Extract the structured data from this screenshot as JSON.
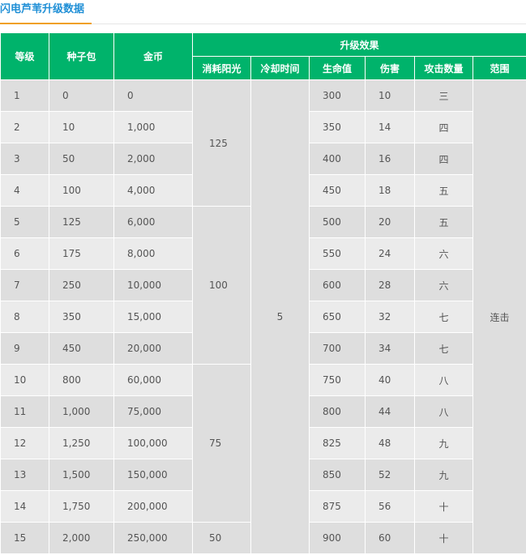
{
  "page_title": "闪电芦苇升级数据",
  "headers": {
    "level": "等级",
    "seeds": "种子包",
    "coins": "金币",
    "effect_group": "升级效果",
    "sun_cost": "消耗阳光",
    "cooldown": "冷却时间",
    "hp": "生命值",
    "damage": "伤害",
    "attack_count": "攻击数量",
    "range": "范围"
  },
  "rows": [
    {
      "level": "1",
      "seeds": "0",
      "coins": "0",
      "hp": "300",
      "damage": "10",
      "count": "三"
    },
    {
      "level": "2",
      "seeds": "10",
      "coins": "1,000",
      "hp": "350",
      "damage": "14",
      "count": "四"
    },
    {
      "level": "3",
      "seeds": "50",
      "coins": "2,000",
      "hp": "400",
      "damage": "16",
      "count": "四"
    },
    {
      "level": "4",
      "seeds": "100",
      "coins": "4,000",
      "hp": "450",
      "damage": "18",
      "count": "五"
    },
    {
      "level": "5",
      "seeds": "125",
      "coins": "6,000",
      "hp": "500",
      "damage": "20",
      "count": "五"
    },
    {
      "level": "6",
      "seeds": "175",
      "coins": "8,000",
      "hp": "550",
      "damage": "24",
      "count": "六"
    },
    {
      "level": "7",
      "seeds": "250",
      "coins": "10,000",
      "hp": "600",
      "damage": "28",
      "count": "六"
    },
    {
      "level": "8",
      "seeds": "350",
      "coins": "15,000",
      "hp": "650",
      "damage": "32",
      "count": "七"
    },
    {
      "level": "9",
      "seeds": "450",
      "coins": "20,000",
      "hp": "700",
      "damage": "34",
      "count": "七"
    },
    {
      "level": "10",
      "seeds": "800",
      "coins": "60,000",
      "hp": "750",
      "damage": "40",
      "count": "八"
    },
    {
      "level": "11",
      "seeds": "1,000",
      "coins": "75,000",
      "hp": "800",
      "damage": "44",
      "count": "八"
    },
    {
      "level": "12",
      "seeds": "1,250",
      "coins": "100,000",
      "hp": "825",
      "damage": "48",
      "count": "九"
    },
    {
      "level": "13",
      "seeds": "1,500",
      "coins": "150,000",
      "hp": "850",
      "damage": "52",
      "count": "九"
    },
    {
      "level": "14",
      "seeds": "1,750",
      "coins": "200,000",
      "hp": "875",
      "damage": "56",
      "count": "十"
    },
    {
      "level": "15",
      "seeds": "2,000",
      "coins": "250,000",
      "hp": "900",
      "damage": "60",
      "count": "十"
    }
  ],
  "sun_cost_groups": [
    {
      "value": "125",
      "rows": 4
    },
    {
      "value": "100",
      "rows": 5
    },
    {
      "value": "75",
      "rows": 5
    },
    {
      "value": "50",
      "rows": 1
    }
  ],
  "cooldown": "5",
  "range": "连击"
}
